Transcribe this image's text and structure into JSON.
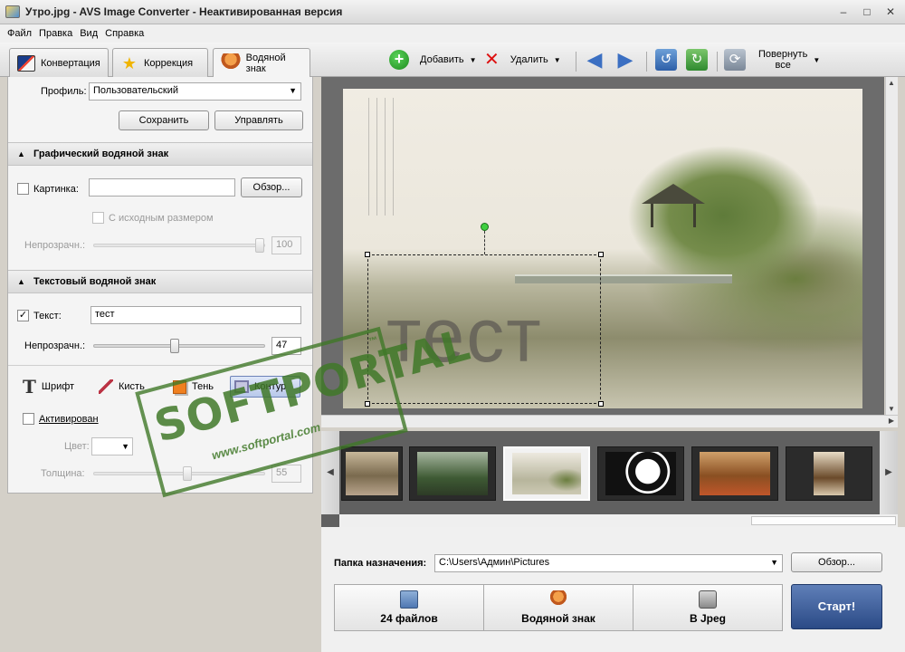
{
  "window": {
    "title": "Утро.jpg - AVS Image Converter - Неактивированная версия",
    "controls": {
      "minimize": "–",
      "maximize": "□",
      "close": "✕"
    }
  },
  "menu": [
    "Файл",
    "Правка",
    "Вид",
    "Справка"
  ],
  "tabs": [
    {
      "label": "Конвертация",
      "icon": "convert-icon"
    },
    {
      "label": "Коррекция",
      "icon": "star-icon"
    },
    {
      "label": "Водяной знак",
      "icon": "stamp-icon",
      "active": true
    }
  ],
  "toolbar": {
    "add_label": "Добавить",
    "delete_label": "Удалить",
    "rotate_all_label_1": "Повернуть",
    "rotate_all_label_2": "все"
  },
  "profile": {
    "label": "Профиль:",
    "value": "Пользовательский",
    "save_label": "Сохранить",
    "manage_label": "Управлять"
  },
  "graphic_watermark": {
    "header": "Графический водяной знак",
    "picture_label": "Картинка:",
    "picture_value": "",
    "browse_label": "Обзор...",
    "original_size_label": "С исходным размером",
    "opacity_label": "Непрозрачн.:",
    "opacity_value": "100",
    "opacity_fraction": 1.0
  },
  "text_watermark": {
    "header": "Текстовый водяной знак",
    "text_label": "Текст:",
    "text_value": "тест",
    "text_checked": true,
    "opacity_label": "Непрозрачн.:",
    "opacity_value": "47",
    "opacity_fraction": 0.47
  },
  "text_tools": [
    "Шрифт",
    "Кисть",
    "Тень",
    "Контур"
  ],
  "outline": {
    "activated_label": "Активирован",
    "color_label": "Цвет:",
    "thickness_label": "Толщина:",
    "thickness_value": "55",
    "thickness_fraction": 0.55
  },
  "preview": {
    "watermark_text": "тест"
  },
  "destination": {
    "label": "Папка назначения:",
    "path": "C:\\Users\\Админ\\Pictures",
    "browse_label": "Обзор..."
  },
  "steps": [
    {
      "label": "24 файлов",
      "icon": "files-icon"
    },
    {
      "label": "Водяной знак",
      "icon": "watermark-step-icon"
    },
    {
      "label": "В Jpeg",
      "icon": "camera-icon"
    }
  ],
  "start_label": "Старт!",
  "stamp": {
    "big": "SOFTPORTAL",
    "small": "www.softportal.com",
    "tm": "™"
  },
  "colors": {
    "stamp": "#407828",
    "accent_blue": "#2b4a86",
    "handle_green": "#3fcf3f"
  }
}
